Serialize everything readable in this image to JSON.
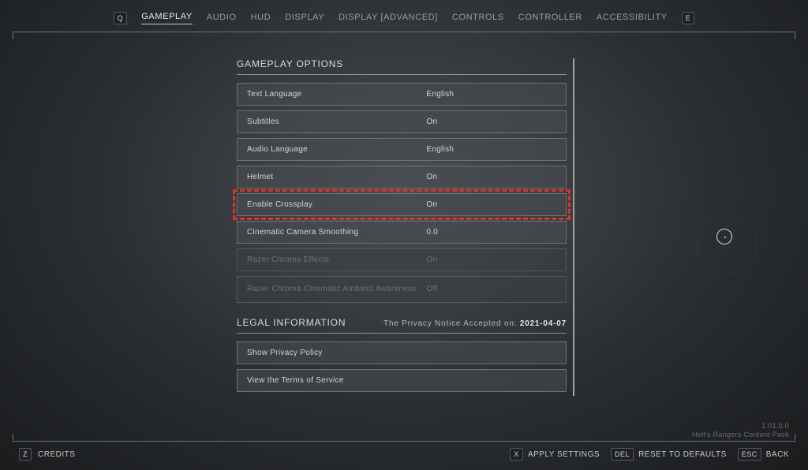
{
  "nav": {
    "prev_key": "Q",
    "next_key": "E",
    "tabs": [
      {
        "label": "GAMEPLAY",
        "active": true
      },
      {
        "label": "AUDIO"
      },
      {
        "label": "HUD"
      },
      {
        "label": "DISPLAY"
      },
      {
        "label": "DISPLAY [ADVANCED]"
      },
      {
        "label": "CONTROLS"
      },
      {
        "label": "CONTROLLER"
      },
      {
        "label": "ACCESSIBILITY"
      }
    ]
  },
  "gameplay": {
    "title": "GAMEPLAY OPTIONS",
    "rows": [
      {
        "label": "Text Language",
        "value": "English"
      },
      {
        "label": "Subtitles",
        "value": "On"
      },
      {
        "label": "Audio Language",
        "value": "English"
      },
      {
        "label": "Helmet",
        "value": "On"
      },
      {
        "label": "Enable Crossplay",
        "value": "On",
        "highlighted": true
      },
      {
        "label": "Cinematic Camera Smoothing",
        "value": "0.0"
      },
      {
        "label": "Razer Chroma Effects",
        "value": "On",
        "disabled": true
      },
      {
        "label": "Razer Chroma Cinematic Ambient Awareness",
        "value": "Off",
        "disabled": true,
        "tall": true
      }
    ]
  },
  "legal": {
    "title": "LEGAL INFORMATION",
    "notice_prefix": "The Privacy Notice Accepted on: ",
    "notice_date": "2021-04-07",
    "links": [
      {
        "label": "Show Privacy Policy"
      },
      {
        "label": "View the Terms of Service"
      }
    ]
  },
  "footer": {
    "credits_key": "Z",
    "credits": "CREDITS",
    "apply_key": "X",
    "apply": "APPLY SETTINGS",
    "reset_key": "DEL",
    "reset": "RESET TO DEFAULTS",
    "back_key": "ESC",
    "back": "BACK"
  },
  "version": {
    "line1": "1.01.0.0",
    "line2": "Hell's Rangers Content Pack"
  }
}
